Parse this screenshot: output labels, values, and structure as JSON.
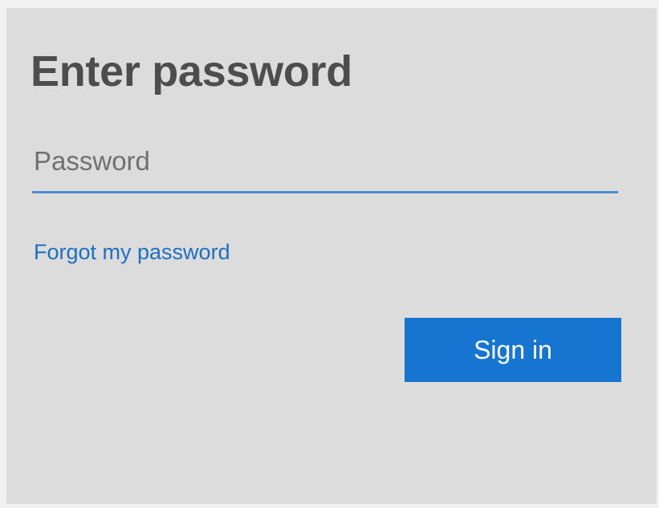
{
  "title": "Enter password",
  "password": {
    "placeholder": "Password",
    "value": ""
  },
  "forgot_link": "Forgot my password",
  "signin_button": "Sign in",
  "colors": {
    "accent": "#1675d1",
    "link": "#1e6fc4",
    "input_underline": "#4a8fd3",
    "panel_background": "#dcdcdc",
    "title_text": "#4d4d4d"
  }
}
